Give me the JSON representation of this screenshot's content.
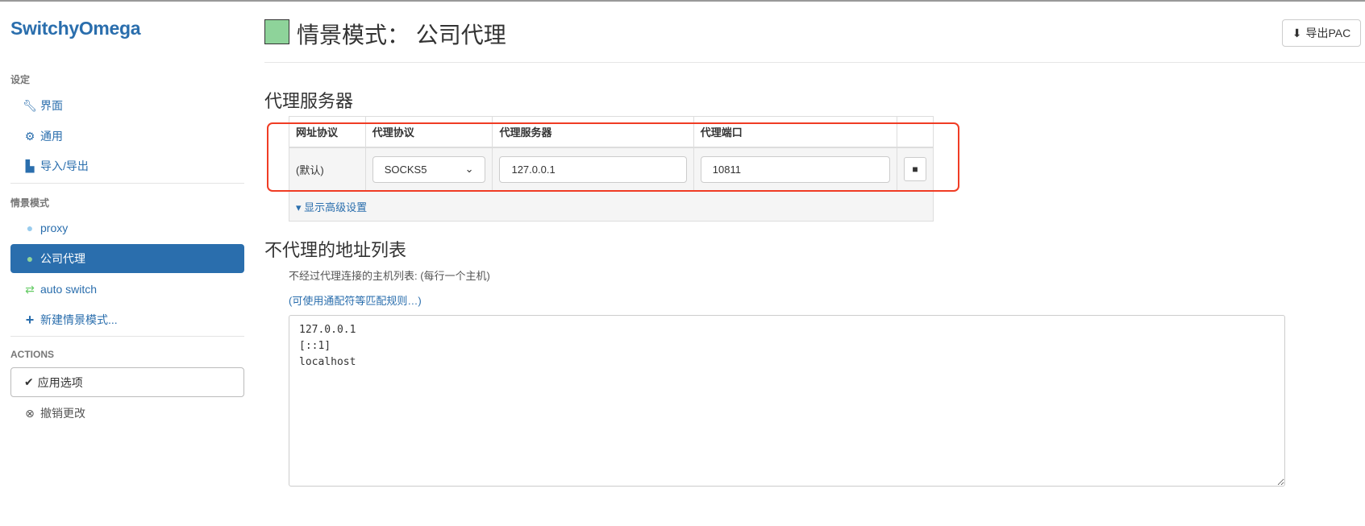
{
  "app": {
    "title": "SwitchyOmega"
  },
  "sidebar": {
    "settings_header": "设定",
    "settings_items": [
      {
        "label": "界面",
        "icon": "wrench-icon"
      },
      {
        "label": "通用",
        "icon": "gear-icon"
      },
      {
        "label": "导入/导出",
        "icon": "import-export-icon"
      }
    ],
    "profiles_header": "情景模式",
    "profiles": [
      {
        "label": "proxy",
        "icon": "globe-icon",
        "color": "#99ccee"
      },
      {
        "label": "公司代理",
        "icon": "globe-icon",
        "color": "#8ed39a",
        "active": true
      },
      {
        "label": "auto switch",
        "icon": "retweet-icon",
        "color": "#66cc66"
      },
      {
        "label": "新建情景模式...",
        "icon": "plus-icon"
      }
    ],
    "actions_header": "ACTIONS",
    "apply_label": "应用选项",
    "discard_label": "撤销更改"
  },
  "header": {
    "title": "情景模式： 公司代理",
    "color": "#8ed39a",
    "export_label": "导出PAC"
  },
  "proxy_servers": {
    "title": "代理服务器",
    "columns": [
      "网址协议",
      "代理协议",
      "代理服务器",
      "代理端口"
    ],
    "row": {
      "scheme": "(默认)",
      "protocol": "SOCKS5",
      "server": "127.0.0.1",
      "port": "10811"
    },
    "advanced_label": "显示高级设置"
  },
  "bypass": {
    "title": "不代理的地址列表",
    "description": "不经过代理连接的主机列表: (每行一个主机)",
    "wildcard_link": "(可使用通配符等匹配规则…)",
    "value": "127.0.0.1\n[::1]\nlocalhost"
  },
  "accent": "#2a6ead",
  "highlight": "#f03c24"
}
